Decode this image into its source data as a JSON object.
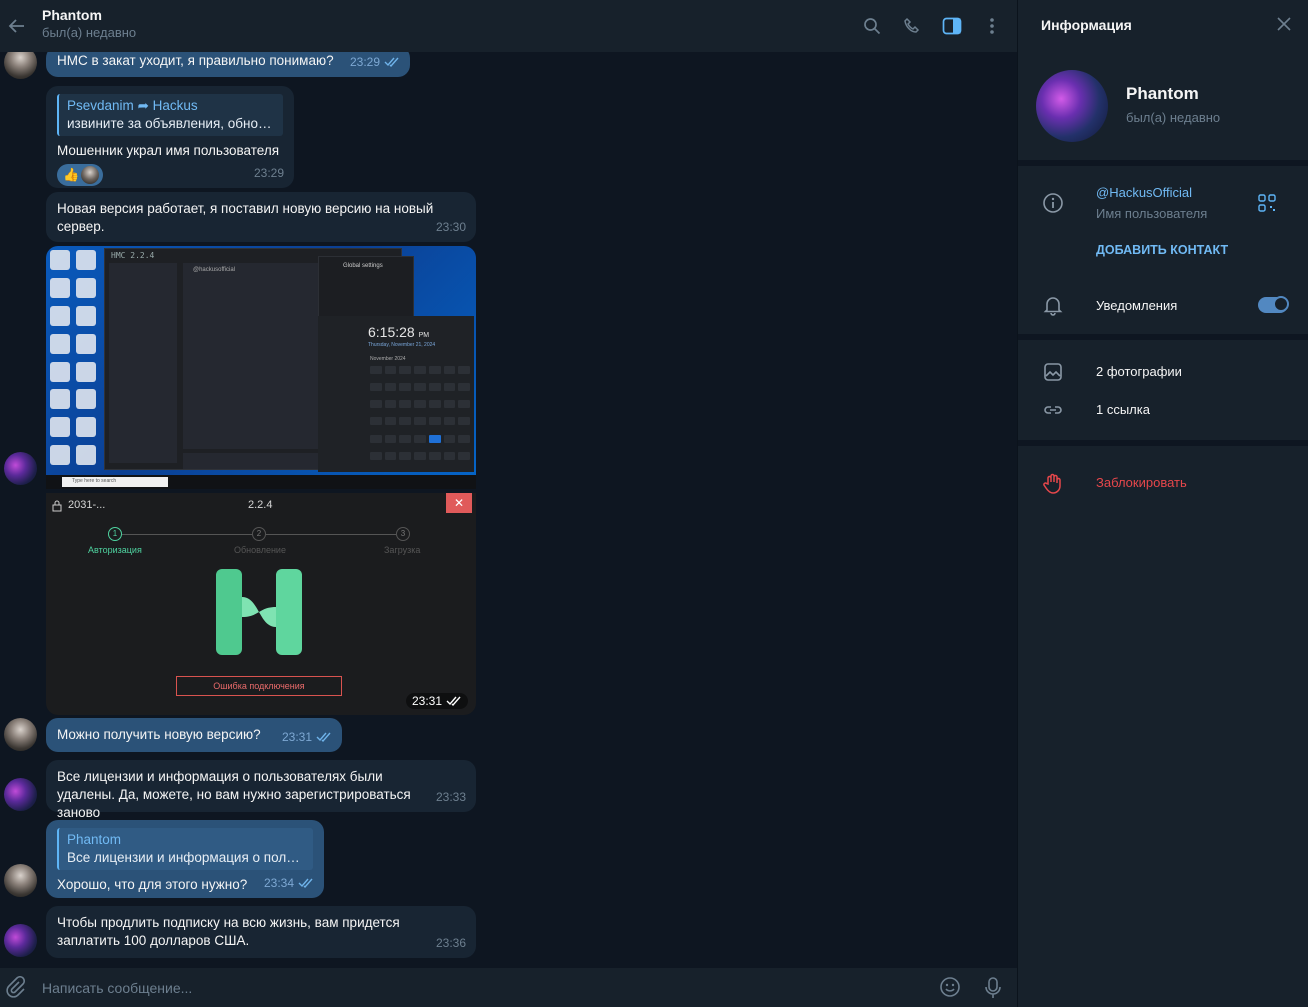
{
  "header": {
    "title": "Phantom",
    "status": "был(а) недавно"
  },
  "messages": {
    "m1": {
      "text": "HMC в закат уходит, я правильно понимаю?",
      "time": "23:29"
    },
    "m2": {
      "reply_name": "Psevdanim",
      "reply_forward": "Hackus",
      "reply_text": "извините за объявления, обнов...",
      "text": "Мошенник украл имя пользователя",
      "time": "23:29",
      "reaction": "👍"
    },
    "m3": {
      "text": "Новая версия работает, я поставил новую версию на новый сервер.",
      "time": "23:30"
    },
    "shot1": {
      "app_name": "HMC 2.2.4",
      "search": "@hackusofficial",
      "settings_title": "Global settings",
      "clock_time": "6:15:28",
      "clock_ampm": "PM",
      "clock_date": "Thursday, November 21, 2024",
      "calendar_month": "November 2024",
      "taskbar_search": "Type here to search"
    },
    "shot2": {
      "lock_title": "2031-...",
      "version": "2.2.4",
      "step1_num": "1",
      "step1": "Авторизация",
      "step2_num": "2",
      "step2": "Обновление",
      "step3_num": "3",
      "step3": "Загрузка",
      "close_glyph": "✕",
      "error": "Ошибка подключения",
      "time": "23:31"
    },
    "m4": {
      "text": "Можно получить новую версию?",
      "time": "23:31"
    },
    "m5": {
      "text": "Все лицензии и информация о пользователях были удалены. Да, можете, но вам нужно зарегистрироваться заново",
      "time": "23:33"
    },
    "m6": {
      "reply_name": "Phantom",
      "reply_text": "Все лицензии и информация о польз...",
      "text": "Хорошо, что для этого нужно?",
      "time": "23:34"
    },
    "m7": {
      "text": "Чтобы продлить подписку на всю жизнь, вам придется заплатить 100 долларов США.",
      "time": "23:36"
    }
  },
  "input": {
    "placeholder": "Написать сообщение..."
  },
  "info": {
    "title": "Информация",
    "name": "Phantom",
    "status": "был(а) недавно",
    "username": "@HackusOfficial",
    "username_label": "Имя пользователя",
    "add_contact": "ДОБАВИТЬ КОНТАКТ",
    "notifications": "Уведомления",
    "notifications_on": true,
    "photos": "2 фотографии",
    "links": "1 ссылка",
    "block": "Заблокировать"
  },
  "colors": {
    "bg": "#0e1621",
    "panel": "#17212b",
    "bubble_in": "#182533",
    "bubble_out": "#2b5278",
    "accent": "#71baf4",
    "danger": "#e5474b"
  }
}
